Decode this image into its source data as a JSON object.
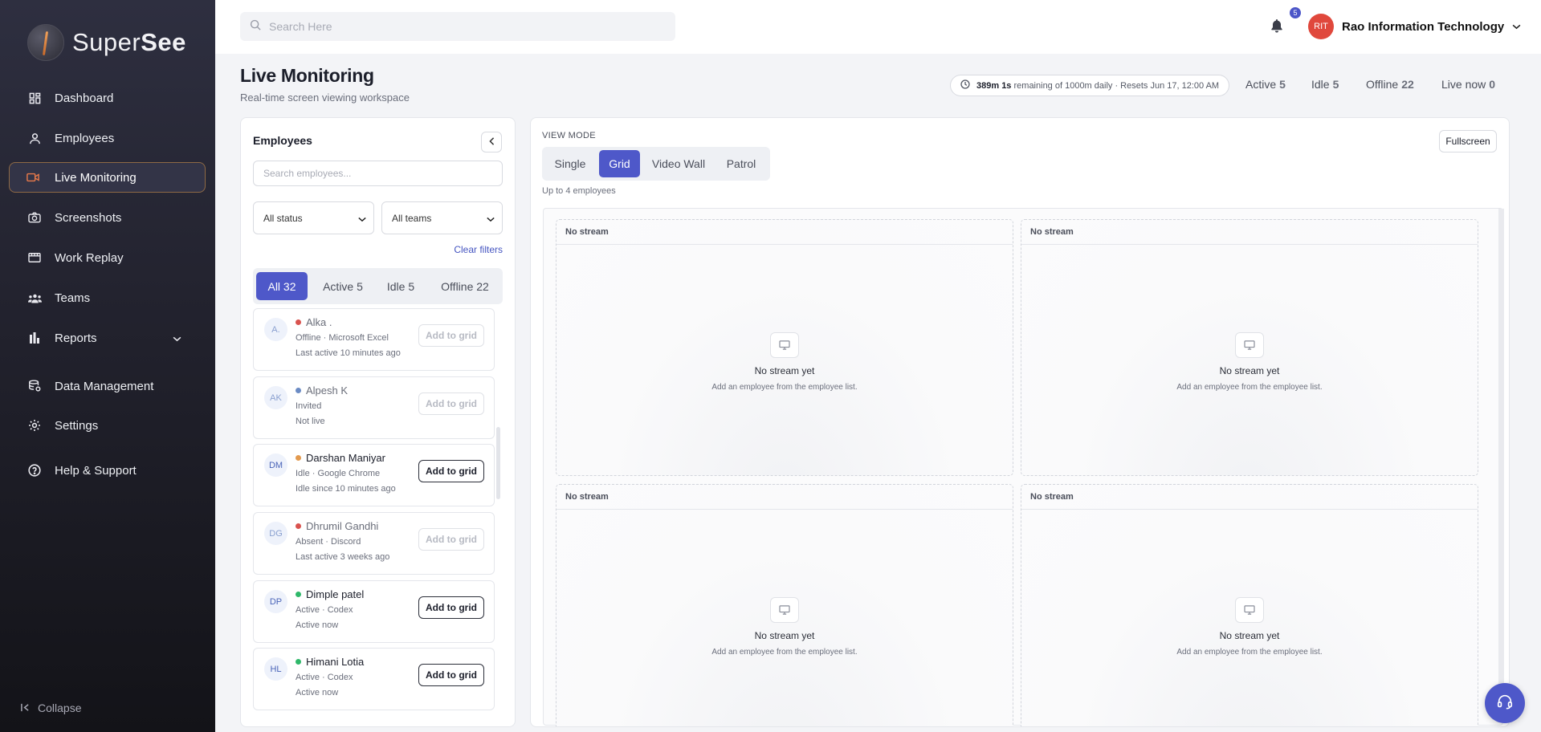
{
  "brand": {
    "name_light": "Super",
    "name_bold": "See"
  },
  "sidebar": {
    "items": [
      {
        "label": "Dashboard",
        "icon": "dashboard-icon"
      },
      {
        "label": "Employees",
        "icon": "user-icon"
      },
      {
        "label": "Live Monitoring",
        "icon": "video-icon",
        "active": true
      },
      {
        "label": "Screenshots",
        "icon": "camera-icon"
      },
      {
        "label": "Work Replay",
        "icon": "film-icon"
      },
      {
        "label": "Teams",
        "icon": "team-icon"
      },
      {
        "label": "Reports",
        "icon": "bar-chart-icon"
      },
      {
        "label": "Data Management",
        "icon": "database-icon"
      },
      {
        "label": "Settings",
        "icon": "gear-icon"
      },
      {
        "label": "Help & Support",
        "icon": "help-icon"
      }
    ],
    "collapse_label": "Collapse"
  },
  "topbar": {
    "search_placeholder": "Search Here",
    "notification_count": "5",
    "org_initials": "RIT",
    "org_name": "Rao Information Technology"
  },
  "header": {
    "title": "Live Monitoring",
    "subtitle": "Real-time screen viewing workspace",
    "quota_bold": "389m 1s",
    "quota_rest": "remaining of 1000m daily · Resets Jun 17, 12:00 AM",
    "stats": [
      {
        "label": "Active",
        "value": "5"
      },
      {
        "label": "Idle",
        "value": "5"
      },
      {
        "label": "Offline",
        "value": "22"
      },
      {
        "label": "Live now",
        "value": "0"
      }
    ]
  },
  "employees_panel": {
    "title": "Employees",
    "search_placeholder": "Search employees...",
    "status_filter": "All status",
    "team_filter": "All teams",
    "clear_filters": "Clear filters",
    "tabs": [
      {
        "label": "All 32",
        "active": true
      },
      {
        "label": "Active 5"
      },
      {
        "label": "Idle 5"
      },
      {
        "label": "Offline 22"
      }
    ],
    "add_label": "Add to grid",
    "list": [
      {
        "initials": "A.",
        "name": "Alka .",
        "status_color": "#d9534f",
        "line2": "Offline · Microsoft Excel",
        "line3": "Last active 10 minutes ago",
        "enabled": false
      },
      {
        "initials": "AK",
        "name": "Alpesh K",
        "status_color": "#6b8bc4",
        "line2": "Invited",
        "line3": "Not live",
        "enabled": false
      },
      {
        "initials": "DM",
        "name": "Darshan Maniyar",
        "status_color": "#e39a4f",
        "line2": "Idle · Google Chrome",
        "line3": "Idle since 10 minutes ago",
        "enabled": true
      },
      {
        "initials": "DG",
        "name": "Dhrumil Gandhi",
        "status_color": "#d9534f",
        "line2": "Absent · Discord",
        "line3": "Last active 3 weeks ago",
        "enabled": false
      },
      {
        "initials": "DP",
        "name": "Dimple patel",
        "status_color": "#2fb86a",
        "line2": "Active · Codex",
        "line3": "Active now",
        "enabled": true
      },
      {
        "initials": "HL",
        "name": "Himani Lotia",
        "status_color": "#2fb86a",
        "line2": "Active · Codex",
        "line3": "Active now",
        "enabled": true
      }
    ]
  },
  "view_panel": {
    "view_mode_label": "VIEW MODE",
    "modes": [
      {
        "label": "Single"
      },
      {
        "label": "Grid",
        "active": true
      },
      {
        "label": "Video Wall"
      },
      {
        "label": "Patrol"
      }
    ],
    "limit_text": "Up to 4 employees",
    "fullscreen_label": "Fullscreen",
    "tiles": [
      {
        "header": "No stream",
        "title": "No stream yet",
        "hint": "Add an employee from the employee list."
      },
      {
        "header": "No stream",
        "title": "No stream yet",
        "hint": "Add an employee from the employee list."
      },
      {
        "header": "No stream",
        "title": "No stream yet",
        "hint": "Add an employee from the employee list."
      },
      {
        "header": "No stream",
        "title": "No stream yet",
        "hint": "Add an employee from the employee list."
      }
    ]
  },
  "colors": {
    "accent": "#4e58c9",
    "sidebar_active_border": "#8f6a45",
    "org_avatar": "#e0483c"
  }
}
